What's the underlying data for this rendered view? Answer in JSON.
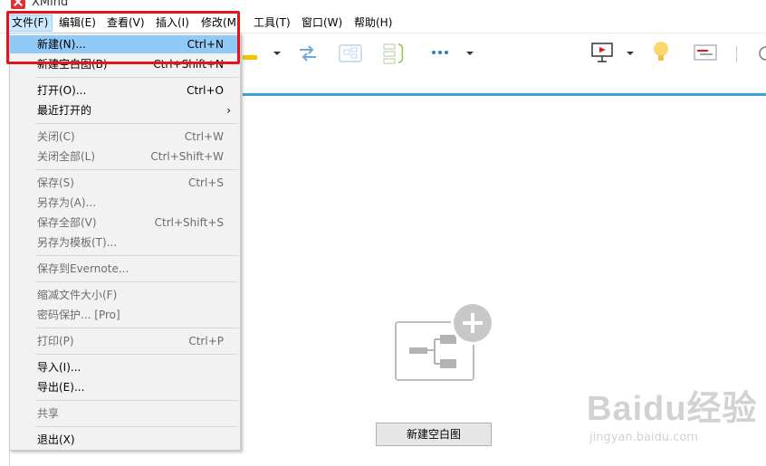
{
  "app": {
    "title": "XMind"
  },
  "menubar": {
    "items": [
      {
        "label": "文件(F)"
      },
      {
        "label": "编辑(E)"
      },
      {
        "label": "查看(V)"
      },
      {
        "label": "插入(I)"
      },
      {
        "label": "修改(M"
      },
      {
        "label": "工具(T)"
      },
      {
        "label": "窗口(W)"
      },
      {
        "label": "帮助(H)"
      }
    ]
  },
  "file_menu": {
    "new": {
      "label": "新建(N)...",
      "shortcut": "Ctrl+N"
    },
    "new_blank": {
      "label": "新建空白图(B)",
      "shortcut": "Ctrl+Shift+N"
    },
    "open": {
      "label": "打开(O)...",
      "shortcut": "Ctrl+O"
    },
    "recent": {
      "label": "最近打开的",
      "arrow": "›"
    },
    "close": {
      "label": "关闭(C)",
      "shortcut": "Ctrl+W"
    },
    "close_all": {
      "label": "关闭全部(L)",
      "shortcut": "Ctrl+Shift+W"
    },
    "save": {
      "label": "保存(S)",
      "shortcut": "Ctrl+S"
    },
    "save_as": {
      "label": "另存为(A)..."
    },
    "save_all": {
      "label": "保存全部(V)",
      "shortcut": "Ctrl+Shift+S"
    },
    "save_as_template": {
      "label": "另存为模板(T)..."
    },
    "save_to_evernote": {
      "label": "保存到Evernote..."
    },
    "reduce_size": {
      "label": "缩减文件大小(F)"
    },
    "password": {
      "label": "密码保护... [Pro]"
    },
    "print": {
      "label": "打印(P)",
      "shortcut": "Ctrl+P"
    },
    "import": {
      "label": "导入(I)..."
    },
    "export": {
      "label": "导出(E)..."
    },
    "share": {
      "label": "共享"
    },
    "exit": {
      "label": "退出(X)"
    }
  },
  "canvas": {
    "blank_button_label": "新建空白图"
  },
  "watermark": {
    "brand": "Baidu经验",
    "url": "jingyan.baidu.com"
  },
  "colors": {
    "highlight": "#91c9f7",
    "annotation_red": "#e3141c",
    "accent_blue": "#3aa0e0"
  }
}
